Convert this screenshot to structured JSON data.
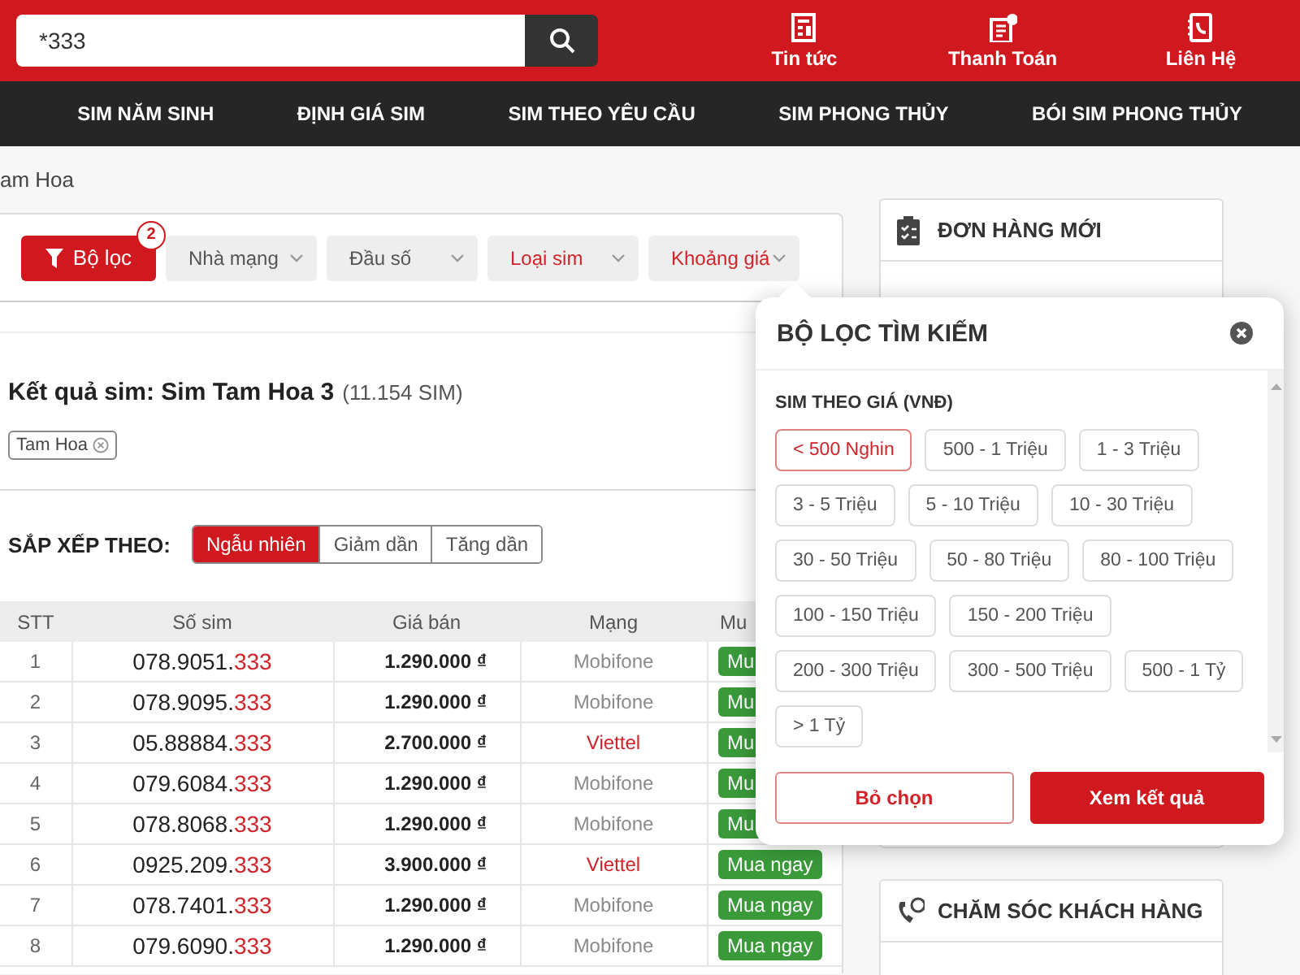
{
  "header": {
    "search": {
      "value": "*333"
    },
    "links": [
      {
        "kind": "news",
        "label": "Tin tức"
      },
      {
        "kind": "payment",
        "label": "Thanh Toán"
      },
      {
        "kind": "contact",
        "label": "Liên Hệ"
      }
    ]
  },
  "nav": [
    "SIM NĂM SINH",
    "ĐỊNH GIÁ SIM",
    "SIM THEO YÊU CẦU",
    "SIM PHONG THỦY",
    "BÓI SIM PHONG THỦY"
  ],
  "breadcrumb": "am Hoa",
  "filter_bar": {
    "button": "Bộ lọc",
    "badge": "2",
    "dropdowns": [
      {
        "label": "Nhà mạng",
        "active": false
      },
      {
        "label": "Đầu số",
        "active": false
      },
      {
        "label": "Loại sim",
        "active": true
      },
      {
        "label": "Khoảng giá",
        "active": true
      }
    ]
  },
  "results": {
    "title": "Kết quả sim: Sim Tam Hoa 3",
    "count": "(11.154 SIM)",
    "tags": [
      "Tam Hoa"
    ]
  },
  "sort": {
    "label": "SẮP XẾP THEO:",
    "options": [
      {
        "label": "Ngẫu nhiên",
        "selected": true
      },
      {
        "label": "Giảm dần",
        "selected": false
      },
      {
        "label": "Tăng dần",
        "selected": false
      }
    ]
  },
  "table": {
    "columns": [
      "STT",
      "Số sim",
      "Giá bán",
      "Mạng",
      "Mu"
    ],
    "rows": [
      {
        "stt": "1",
        "number": "078.9051.",
        "tail": "333",
        "price": "1.290.000 ₫",
        "network": "Mobifone",
        "color": "#8a8a8a",
        "buy": "Mu"
      },
      {
        "stt": "2",
        "number": "078.9095.",
        "tail": "333",
        "price": "1.290.000 ₫",
        "network": "Mobifone",
        "color": "#8a8a8a",
        "buy": "Mu"
      },
      {
        "stt": "3",
        "number": "05.88884.",
        "tail": "333",
        "price": "2.700.000 ₫",
        "network": "Viettel",
        "color": "#d0232a",
        "buy": "Mu"
      },
      {
        "stt": "4",
        "number": "079.6084.",
        "tail": "333",
        "price": "1.290.000 ₫",
        "network": "Mobifone",
        "color": "#8a8a8a",
        "buy": "Mu"
      },
      {
        "stt": "5",
        "number": "078.8068.",
        "tail": "333",
        "price": "1.290.000 ₫",
        "network": "Mobifone",
        "color": "#8a8a8a",
        "buy": "Mu"
      },
      {
        "stt": "6",
        "number": "0925.209.",
        "tail": "333",
        "price": "3.900.000 ₫",
        "network": "Viettel",
        "color": "#d0232a",
        "buy": "Mua ngay"
      },
      {
        "stt": "7",
        "number": "078.7401.",
        "tail": "333",
        "price": "1.290.000 ₫",
        "network": "Mobifone",
        "color": "#8a8a8a",
        "buy": "Mua ngay"
      },
      {
        "stt": "8",
        "number": "079.6090.",
        "tail": "333",
        "price": "1.290.000 ₫",
        "network": "Mobifone",
        "color": "#8a8a8a",
        "buy": "Mua ngay"
      }
    ]
  },
  "sidebar": [
    {
      "kind": "orders",
      "title": "ĐƠN HÀNG MỚI"
    },
    {
      "kind": "support",
      "title": "CHĂM SÓC KHÁCH HÀNG"
    }
  ],
  "popup": {
    "title": "BỘ LỌC TÌM KIẾM",
    "section": "SIM THEO GIÁ (VNĐ)",
    "chips": [
      {
        "label": "< 500 Nghin",
        "selected": true
      },
      {
        "label": "500 - 1 Triệu",
        "selected": false
      },
      {
        "label": "1 - 3 Triệu",
        "selected": false
      },
      {
        "label": "3 - 5 Triệu",
        "selected": false
      },
      {
        "label": "5 - 10 Triệu",
        "selected": false
      },
      {
        "label": "10 - 30 Triệu",
        "selected": false
      },
      {
        "label": "30 - 50 Triệu",
        "selected": false
      },
      {
        "label": "50 - 80 Triệu",
        "selected": false
      },
      {
        "label": "80 - 100 Triệu",
        "selected": false
      },
      {
        "label": "100 - 150 Triệu",
        "selected": false
      },
      {
        "label": "150 - 200 Triệu",
        "selected": false
      },
      {
        "label": "200 - 300 Triệu",
        "selected": false
      },
      {
        "label": "300 - 500 Triệu",
        "selected": false
      },
      {
        "label": "500 - 1 Tỷ",
        "selected": false
      },
      {
        "label": "> 1 Tỷ",
        "selected": false
      }
    ],
    "buttons": [
      {
        "kind": "secondary",
        "label": "Bỏ chọn"
      },
      {
        "kind": "primary",
        "label": "Xem kết quả"
      }
    ]
  }
}
